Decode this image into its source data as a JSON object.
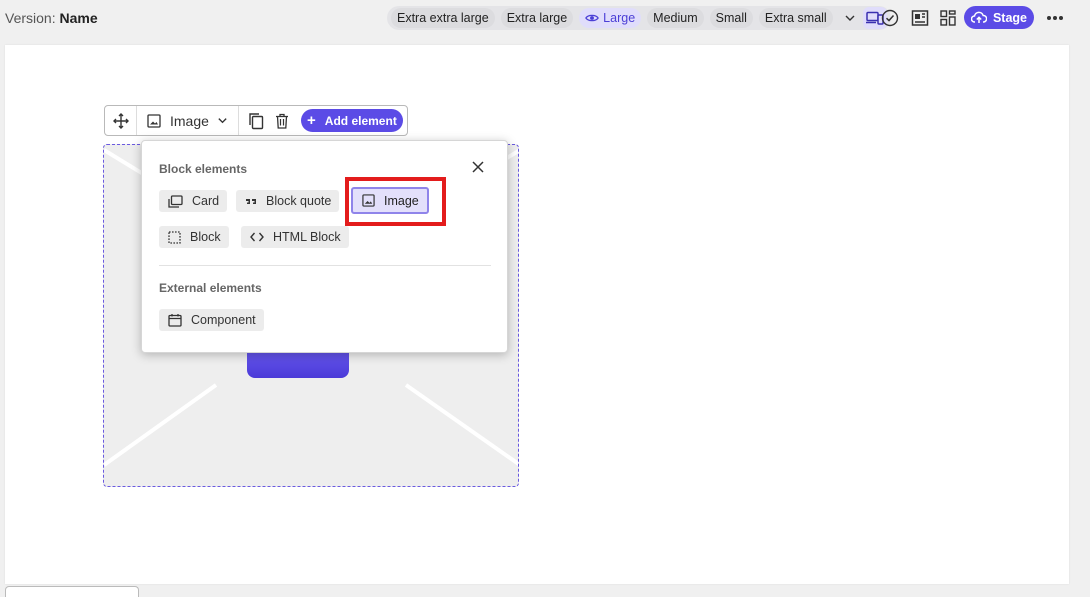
{
  "header": {
    "version_label": "Version:",
    "version_name": "Name",
    "breakpoints": [
      {
        "label": "Extra extra large",
        "active": false
      },
      {
        "label": "Extra large",
        "active": false
      },
      {
        "label": "Large",
        "active": true
      },
      {
        "label": "Medium",
        "active": false
      },
      {
        "label": "Small",
        "active": false
      },
      {
        "label": "Extra small",
        "active": false
      }
    ],
    "icons": [
      "chevron-down-icon",
      "responsive-device-icon",
      "check-circle-icon",
      "layout-panel-icon",
      "grid-layout-icon",
      "cloud-upload-icon",
      "more-horizontal-icon"
    ],
    "stage_label": "Stage"
  },
  "element_toolbar": {
    "type_label": "Image",
    "add_label": "Add element"
  },
  "popover": {
    "block_title": "Block elements",
    "block_items": [
      {
        "label": "Card",
        "icon": "card-icon"
      },
      {
        "label": "Block quote",
        "icon": "quote-icon"
      },
      {
        "label": "Image",
        "icon": "image-icon",
        "selected": true
      },
      {
        "label": "Block",
        "icon": "block-icon"
      },
      {
        "label": "HTML Block",
        "icon": "code-icon"
      }
    ],
    "external_title": "External elements",
    "external_items": [
      {
        "label": "Component",
        "icon": "component-icon"
      }
    ]
  },
  "colors": {
    "accent": "#5b4be6",
    "highlight": "#e31c1c",
    "active_chip_bg": "#e0ddfb"
  }
}
